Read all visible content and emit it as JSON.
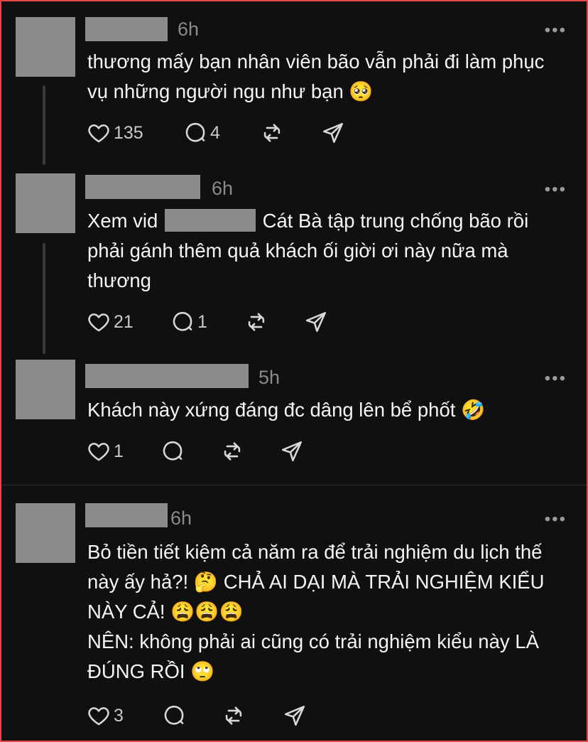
{
  "posts": [
    {
      "time": "6h",
      "text": "thương mấy bạn nhân viên bão vẫn phải đi làm phục vụ những người ngu như bạn 🥺",
      "likes": "135",
      "replies": "4"
    },
    {
      "time": "6h",
      "text_before": "Xem vid",
      "text_after": "Cát Bà tập trung chống bão rồi phải gánh thêm quả khách ối giời ơi này nữa mà thương",
      "likes": "21",
      "replies": "1"
    },
    {
      "time": "5h",
      "text": "Khách này xứng đáng đc dâng lên bể phốt 🤣",
      "likes": "1",
      "replies": ""
    },
    {
      "time": "6h",
      "text_line1": "Bỏ tiền tiết kiệm cả năm ra để trải nghiệm du lịch thế này ấy hả?! 🤔 CHẢ AI DẠI MÀ TRẢI NGHIỆM KIỂU NÀY CẢ! 😩😩😩",
      "text_line2": "NÊN: không phải ai cũng có trải nghiệm kiểu này LÀ ĐÚNG RỒI 🙄",
      "likes": "3",
      "replies": ""
    }
  ],
  "more_label": "•••"
}
